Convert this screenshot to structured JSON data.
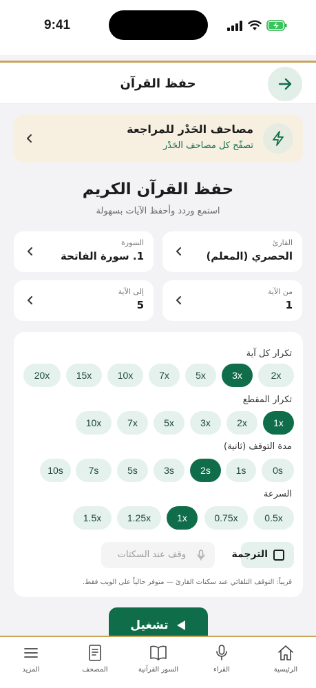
{
  "status_bar": {
    "time": "9:41"
  },
  "header": {
    "title": "حفظ القرآن",
    "back_icon": "arrow-right-icon"
  },
  "banner": {
    "title": "مصاحف الحَدْر للمراجعة",
    "subtitle": "تصفّح كل مصاحف الحَدْر",
    "icon": "lightning-icon"
  },
  "page": {
    "title": "حفظ القرآن الكريم",
    "subtitle": "استمع وردد وأحفظ الآيات بسهولة"
  },
  "selectors": {
    "reciter": {
      "label": "القارئ",
      "value": "الحصري (المعلم)"
    },
    "surah": {
      "label": "السورة",
      "value": "1. سورة الفاتحة"
    },
    "from_ayah": {
      "label": "من الآية",
      "value": "1"
    },
    "to_ayah": {
      "label": "إلى الآية",
      "value": "5"
    }
  },
  "options": {
    "ayah_repeat": {
      "label": "تكرار كل آية",
      "chips": [
        "2x",
        "3x",
        "5x",
        "7x",
        "10x",
        "15x",
        "20x"
      ],
      "selected": "3x"
    },
    "segment_repeat": {
      "label": "تكرار المقطع",
      "chips": [
        "1x",
        "2x",
        "3x",
        "5x",
        "7x",
        "10x"
      ],
      "selected": "1x"
    },
    "pause_duration": {
      "label": "مدة التوقف (ثانية)",
      "chips": [
        "0s",
        "1s",
        "2s",
        "3s",
        "5s",
        "7s",
        "10s"
      ],
      "selected": "2s"
    },
    "speed": {
      "label": "السرعة",
      "chips": [
        "0.5x",
        "0.75x",
        "1x",
        "1.25x",
        "1.5x"
      ],
      "selected": "1x"
    },
    "translation_label": "الترجمة",
    "pause_at_silence_label": "وقف عند السكتات",
    "note": "قريباً: التوقف التلقائي عند سكتات القارئ — متوفر حالياً على الويب فقط."
  },
  "play_button": {
    "label": "تشغيل"
  },
  "tabbar": {
    "items": [
      {
        "label": "الرئيسية",
        "icon": "home-icon"
      },
      {
        "label": "القراء",
        "icon": "microphone-icon"
      },
      {
        "label": "السور القرآنية",
        "icon": "open-book-icon"
      },
      {
        "label": "المصحف",
        "icon": "mushaf-icon"
      },
      {
        "label": "المزيد",
        "icon": "menu-icon"
      }
    ]
  },
  "colors": {
    "primary": "#0f6d4a",
    "accent_gold": "#c9a35a",
    "chip_bg": "#e5f1ec",
    "banner_bg": "#f7f0e1"
  }
}
